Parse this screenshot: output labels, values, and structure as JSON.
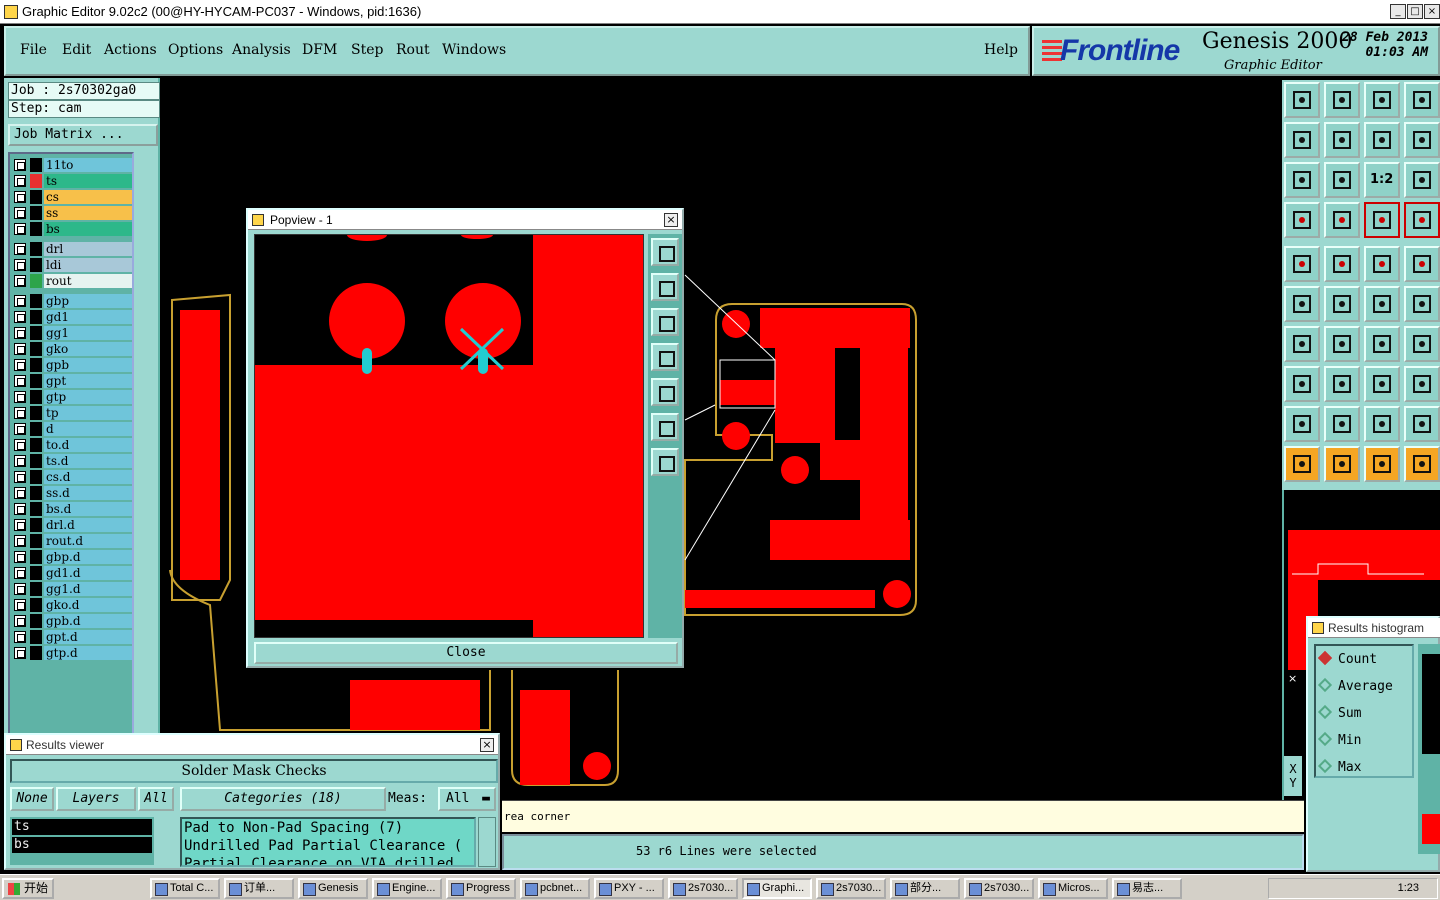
{
  "window": {
    "title": "Graphic Editor 9.02c2 (00@HY-HYCAM-PC037 - Windows, pid:1636)"
  },
  "menu": {
    "items": [
      "File",
      "Edit",
      "Actions",
      "Options",
      "Analysis",
      "DFM",
      "Step",
      "Rout",
      "Windows"
    ],
    "help": "Help"
  },
  "brand": {
    "logo": "Frontline",
    "product": "Genesis 2000",
    "subtitle": "Graphic Editor",
    "date_line1": "28 Feb 2013",
    "date_line2": "01:03 AM"
  },
  "job": {
    "job_line": "Job : 2s70302ga0",
    "step_line": "Step: cam",
    "matrix_button": "Job Matrix ..."
  },
  "layers": [
    {
      "name": "11to",
      "color": "#6fc5da",
      "swatch": "#000000"
    },
    {
      "name": "ts",
      "color": "#2db88a",
      "swatch": "#e83030",
      "active": true
    },
    {
      "name": "cs",
      "color": "#f7c04a",
      "swatch": "#000000"
    },
    {
      "name": "ss",
      "color": "#f7c04a",
      "swatch": "#000000"
    },
    {
      "name": "bs",
      "color": "#2db88a",
      "swatch": "#000000"
    },
    {
      "name": "drl",
      "color": "#a8c8d8",
      "swatch": "#000000"
    },
    {
      "name": "ldi",
      "color": "#a8c8d8",
      "swatch": "#000000"
    },
    {
      "name": "rout",
      "color": "#e6f3f0",
      "swatch": "#2da44a"
    },
    {
      "name": "gbp",
      "color": "#6fc5da",
      "swatch": "#000000"
    },
    {
      "name": "gd1",
      "color": "#6fc5da",
      "swatch": "#000000"
    },
    {
      "name": "gg1",
      "color": "#6fc5da",
      "swatch": "#000000"
    },
    {
      "name": "gko",
      "color": "#6fc5da",
      "swatch": "#000000"
    },
    {
      "name": "gpb",
      "color": "#6fc5da",
      "swatch": "#000000"
    },
    {
      "name": "gpt",
      "color": "#6fc5da",
      "swatch": "#000000"
    },
    {
      "name": "gtp",
      "color": "#6fc5da",
      "swatch": "#000000"
    },
    {
      "name": "tp",
      "color": "#6fc5da",
      "swatch": "#000000"
    },
    {
      "name": "d",
      "color": "#6fc5da",
      "swatch": "#000000"
    },
    {
      "name": "to.d",
      "color": "#6fc5da",
      "swatch": "#000000"
    },
    {
      "name": "ts.d",
      "color": "#6fc5da",
      "swatch": "#000000"
    },
    {
      "name": "cs.d",
      "color": "#6fc5da",
      "swatch": "#000000"
    },
    {
      "name": "ss.d",
      "color": "#6fc5da",
      "swatch": "#000000"
    },
    {
      "name": "bs.d",
      "color": "#6fc5da",
      "swatch": "#000000"
    },
    {
      "name": "drl.d",
      "color": "#6fc5da",
      "swatch": "#000000"
    },
    {
      "name": "rout.d",
      "color": "#6fc5da",
      "swatch": "#000000"
    },
    {
      "name": "gbp.d",
      "color": "#6fc5da",
      "swatch": "#000000"
    },
    {
      "name": "gd1.d",
      "color": "#6fc5da",
      "swatch": "#000000"
    },
    {
      "name": "gg1.d",
      "color": "#6fc5da",
      "swatch": "#000000"
    },
    {
      "name": "gko.d",
      "color": "#6fc5da",
      "swatch": "#000000"
    },
    {
      "name": "gpb.d",
      "color": "#6fc5da",
      "swatch": "#000000"
    },
    {
      "name": "gpt.d",
      "color": "#6fc5da",
      "swatch": "#000000"
    },
    {
      "name": "gtp.d",
      "color": "#6fc5da",
      "swatch": "#000000"
    }
  ],
  "popview": {
    "title": "Popview - 1",
    "close_label": "Close",
    "tools": [
      "zoom-fit-icon",
      "zoom-in-icon",
      "zoom-out-icon",
      "pan-left-icon",
      "pan-right-icon",
      "fit-all-icon",
      "center-icon"
    ]
  },
  "right_tools": {
    "rows": [
      [
        "home-icon",
        "save-icon",
        "house-icon",
        "window-icon"
      ],
      [
        "pan-left-icon",
        "pan-right-icon",
        "mirror-icon",
        "snap-icon"
      ],
      [
        "fit-icon",
        "center-icon",
        "scale-1to2-icon",
        "help-icon"
      ],
      [
        "measure-icon",
        "grid-icon",
        "layer-red-icon",
        "layer-red2-icon"
      ],
      [
        "target-icon",
        "edit-shape-icon",
        "ruler-icon",
        "circle-icon"
      ],
      [
        "node-icon",
        "delete-node-icon",
        "move-icon",
        "connect-icon"
      ],
      [
        "angle-icon",
        "line-icon",
        "rotate-icon",
        "flip-icon"
      ],
      [
        "point-icon",
        "minus-icon",
        "resize-icon",
        "group-icon"
      ],
      [
        "triangle-icon",
        "triangle-up-icon",
        "triangle-line-icon",
        "triangle-line2-icon"
      ],
      [
        "pointer-icon",
        "pointer2-icon",
        "pointer3-icon",
        "pointer4-icon"
      ]
    ],
    "scale_label": "1:2"
  },
  "histogram": {
    "title": "Results histogram",
    "options": [
      "Count",
      "Average",
      "Sum",
      "Min",
      "Max"
    ],
    "selected": "Count"
  },
  "results": {
    "title": "Results viewer",
    "header": "Solder Mask Checks",
    "btn_none": "None",
    "btn_layers": "Layers",
    "btn_all": "All",
    "categories_btn": "Categories (18)",
    "meas_label": "Meas:",
    "meas_value": "All",
    "layer_list": [
      "ts",
      "bs"
    ],
    "category_list": [
      "Pad to Non-Pad Spacing (7)",
      "Undrilled Pad Partial Clearance (",
      "Partial Clearance on VIA drilled"
    ]
  },
  "status": {
    "hint": "rea corner",
    "selection": "53 r6 Lines were selected"
  },
  "coord": {
    "x_label": "X",
    "y_label": "Y"
  },
  "taskbar": {
    "start": "开始",
    "items": [
      "Total C...",
      "订单...",
      "Genesis",
      "Engine...",
      "Progress",
      "pcbnet...",
      "PXY - ...",
      "2s7030...",
      "Graphi...",
      "2s7030...",
      "部分...",
      "2s7030...",
      "Micros...",
      "易志..."
    ],
    "active": "Graphi...",
    "clock": "1:23"
  },
  "colors": {
    "panel": "#9cd8d0",
    "copper": "#ff0000",
    "outline": "#c8a030",
    "cursor": "#22ccd0"
  }
}
